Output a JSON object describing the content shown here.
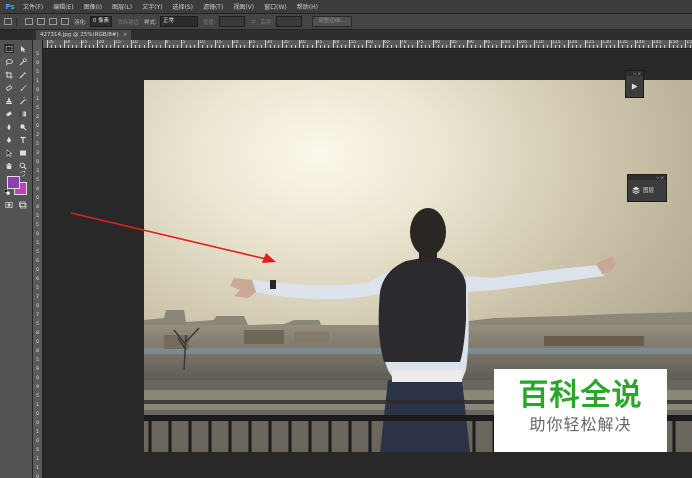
{
  "app": {
    "logo": "Ps"
  },
  "menu": [
    "文件(F)",
    "编辑(E)",
    "图像(I)",
    "图层(L)",
    "文字(Y)",
    "选择(S)",
    "滤镜(T)",
    "视图(V)",
    "窗口(W)",
    "帮助(H)"
  ],
  "options": {
    "feather_label": "羽化:",
    "feather_value": "0 像素",
    "antialias_label": "消除锯齿",
    "style_label": "样式:",
    "style_value": "正常",
    "width_label": "宽度:",
    "height_label": "高度:",
    "refine_edge_button": "调整边缘..."
  },
  "document": {
    "tab_title": "427314.jpg @ 25%(RGB/8#)",
    "close_glyph": "×"
  },
  "rulers": {
    "top": [
      "35",
      "30",
      "25",
      "20",
      "15",
      "10",
      "5",
      "0",
      "5",
      "10",
      "15",
      "20",
      "25",
      "30",
      "35",
      "40",
      "45",
      "50",
      "55",
      "60",
      "65",
      "70",
      "75",
      "80",
      "85",
      "90",
      "95",
      "100",
      "105",
      "110",
      "115",
      "120",
      "125",
      "130",
      "135",
      "140",
      "145",
      "150",
      "155"
    ],
    "left": [
      "5",
      "0",
      "5",
      "1",
      "0",
      "1",
      "5",
      "2",
      "0",
      "2",
      "5",
      "3",
      "0",
      "3",
      "5",
      "4",
      "0",
      "4",
      "5",
      "5",
      "0",
      "5",
      "5",
      "6",
      "0",
      "6",
      "5",
      "7",
      "0",
      "7",
      "5",
      "8",
      "0",
      "8",
      "5",
      "9",
      "0",
      "9",
      "5",
      "1",
      "0",
      "0",
      "1",
      "0",
      "5",
      "1",
      "1",
      "0"
    ]
  },
  "tools": {
    "foreground_color": "#8b3fb0",
    "background_color": "#c43fb6"
  },
  "panels": {
    "history_icon": "play-icon",
    "layers_label": "图层"
  },
  "watermark": {
    "title": "百科全说",
    "subtitle": "助你轻松解决",
    "title_color": "#2aa62a"
  },
  "annotation": {
    "arrow_color": "#e02020"
  }
}
